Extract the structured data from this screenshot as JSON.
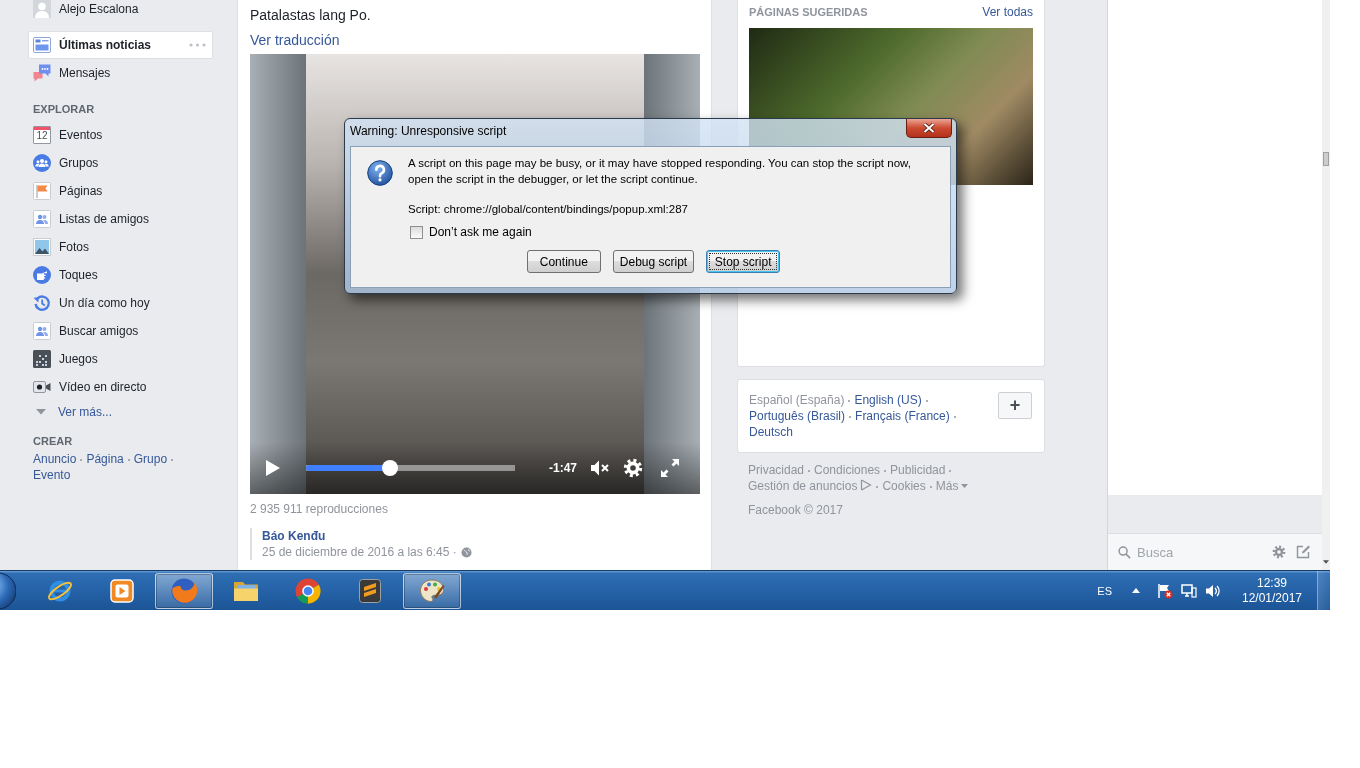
{
  "sidebar": {
    "profile": {
      "name": "Alejo Escalona"
    },
    "feed": [
      {
        "label": "Últimas noticias",
        "selected": true
      },
      {
        "label": "Mensajes",
        "selected": false
      }
    ],
    "explore": {
      "heading": "EXPLORAR",
      "items": [
        {
          "label": "Eventos",
          "icon_text": "12",
          "selected": false
        },
        {
          "label": "Grupos",
          "selected": false
        },
        {
          "label": "Páginas",
          "selected": false
        },
        {
          "label": "Listas de amigos",
          "selected": false
        },
        {
          "label": "Fotos",
          "selected": false
        },
        {
          "label": "Toques",
          "selected": false
        },
        {
          "label": "Un día como hoy",
          "selected": false
        },
        {
          "label": "Buscar amigos",
          "selected": false
        },
        {
          "label": "Juegos",
          "selected": false
        },
        {
          "label": "Vídeo en directo",
          "selected": false
        }
      ],
      "more": "Ver más..."
    },
    "create": {
      "heading": "CREAR",
      "links": [
        "Anuncio",
        "Página",
        "Grupo",
        "Evento"
      ]
    }
  },
  "post": {
    "text": "Patalastas lang Po.",
    "translate": "Ver traducción",
    "video": {
      "playing": false,
      "level": 0.4,
      "time": "-1:47",
      "muted": true
    },
    "views": "2 935 911 reproducciones",
    "comment": {
      "author": "Báo Kenđu",
      "date": "25 de diciembre de 2016 a las 6:45 ·"
    }
  },
  "right_column": {
    "suggested": {
      "title": "PÁGINAS SUGERIDAS",
      "see_all": "Ver todas"
    },
    "languages": {
      "items": [
        {
          "label": "Español (España)",
          "selected": true
        },
        {
          "label": "English (US)",
          "selected": false
        },
        {
          "label": "Português (Brasil)",
          "selected": false
        },
        {
          "label": "Français (France)",
          "selected": false
        },
        {
          "label": "Deutsch",
          "selected": false
        }
      ],
      "add": "+"
    },
    "footer_links": [
      {
        "label": "Privacidad",
        "kind": "plain"
      },
      {
        "label": "Condiciones",
        "kind": "plain"
      },
      {
        "label": "Publicidad",
        "kind": "plain"
      },
      {
        "label": "Gestión de anuncios",
        "kind": "adchoices"
      },
      {
        "label": "Cookies",
        "kind": "plain"
      },
      {
        "label": "Más",
        "kind": "menu"
      }
    ],
    "copyright": "Facebook © 2017"
  },
  "chat": {
    "search": {
      "placeholder": "Busca"
    }
  },
  "dialog": {
    "title": "Warning: Unresponsive script",
    "message": "A script on this page may be busy, or it may have stopped responding. You can stop the script now, open the script in the debugger, or let the script continue.",
    "script": "Script: chrome://global/content/bindings/popup.xml:287",
    "checkbox": {
      "label": "Don’t ask me again",
      "checked": false
    },
    "buttons": [
      {
        "label": "Continue",
        "focused": false
      },
      {
        "label": "Debug script",
        "focused": false
      },
      {
        "label": "Stop script",
        "focused": true
      }
    ]
  },
  "taskbar": {
    "apps": [
      {
        "open": false
      },
      {
        "open": false
      },
      {
        "open": true
      },
      {
        "open": false
      },
      {
        "open": false
      },
      {
        "open": false
      },
      {
        "open": true
      }
    ],
    "language": "ES",
    "time": "12:39",
    "date": "12/01/2017"
  }
}
